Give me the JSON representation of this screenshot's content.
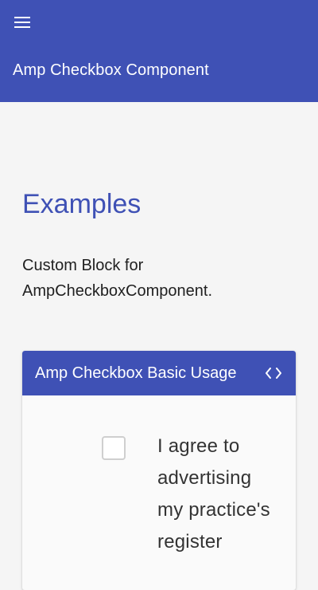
{
  "header": {
    "menu_icon": "hamburger-menu-icon",
    "title": "Amp Checkbox Component"
  },
  "main": {
    "heading": "Examples",
    "description": "Custom Block for AmpCheckboxComponent."
  },
  "example_card": {
    "title": "Amp Checkbox Basic Usage",
    "code_icon": "code-brackets-icon",
    "checkbox": {
      "checked": false,
      "label": "I agree to advertising my practice's register"
    }
  },
  "colors": {
    "primary": "#3f51b5",
    "background": "#f5f5f5",
    "card_background": "#fafafa",
    "text": "#212121"
  }
}
